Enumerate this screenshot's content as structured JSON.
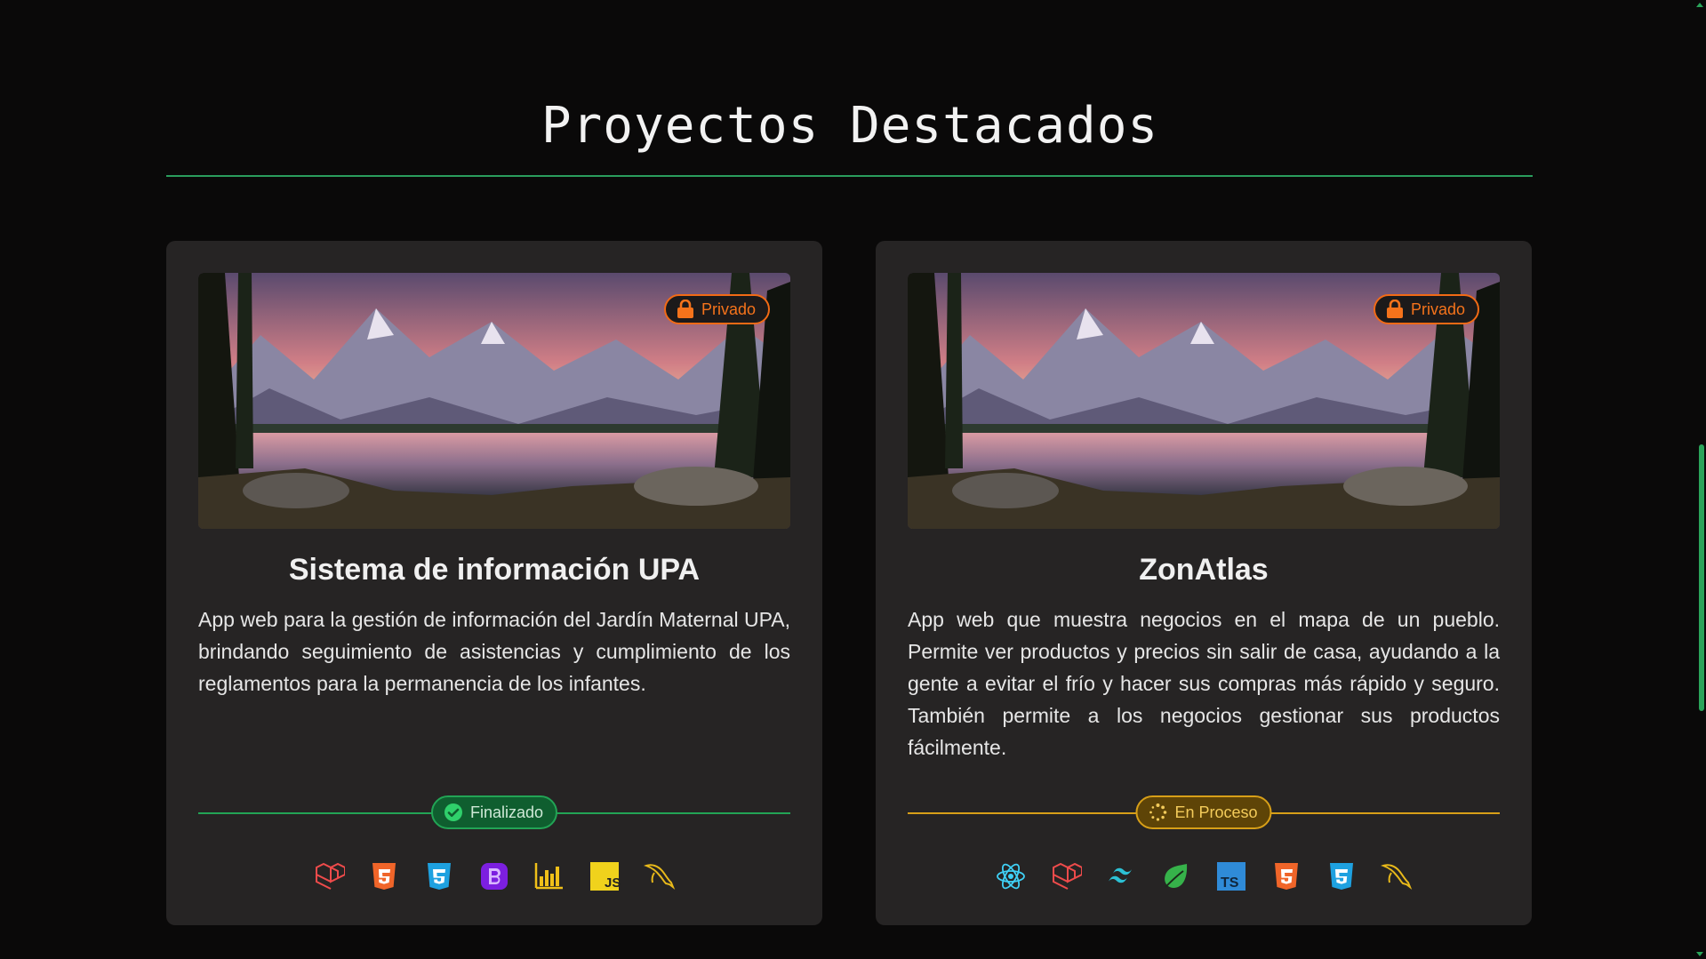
{
  "section": {
    "title": "Proyectos Destacados"
  },
  "colors": {
    "accent": "#2a9d5c",
    "card_bg": "#262424",
    "private_badge": "#f26a15",
    "done": "#22a455",
    "in_progress": "#d79f18"
  },
  "projects": [
    {
      "title": "Sistema de información UPA",
      "visibility_label": "Privado",
      "visibility_icon": "lock-icon",
      "description": "App web para la gestión de información del Jardín Maternal UPA, brindando seguimiento de asistencias y cumplimiento de los reglamentos para la permanencia de los infantes.",
      "status_label": "Finalizado",
      "status_icon": "check-circle-icon",
      "technologies": [
        "laravel-icon",
        "html5-icon",
        "css3-icon",
        "bootstrap-icon",
        "chart-icon",
        "javascript-icon",
        "mysql-icon"
      ]
    },
    {
      "title": "ZonAtlas",
      "visibility_label": "Privado",
      "visibility_icon": "lock-icon",
      "description": "App web que muestra negocios en el mapa de un pueblo. Permite ver productos y precios sin salir de casa, ayudando a la gente a evitar el frío y hacer sus compras más rápido y seguro. También permite a los negocios gestionar sus productos fácilmente.",
      "status_label": "En Proceso",
      "status_icon": "loading-dots-icon",
      "technologies": [
        "react-icon",
        "laravel-icon",
        "tailwind-icon",
        "spring-icon",
        "typescript-icon",
        "html5-icon",
        "css3-icon",
        "mysql-icon"
      ]
    }
  ]
}
